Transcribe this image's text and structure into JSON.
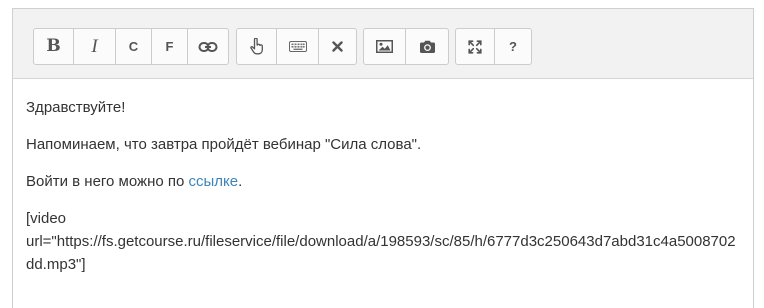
{
  "toolbar": {
    "formatting": {
      "bold_label": "B",
      "italic_label": "I",
      "c_label": "C",
      "f_label": "F"
    },
    "icons": {
      "link": "link-icon",
      "hand": "hand-pointer-icon",
      "keyboard": "keyboard-icon",
      "clear": "close-icon",
      "image": "image-icon",
      "camera": "camera-icon",
      "fullscreen": "fullscreen-icon"
    },
    "help_label": "?"
  },
  "content": {
    "greeting": "Здравствуйте!",
    "reminder": "Напоминаем, что завтра пройдёт вебинар \"Сила слова\".",
    "login_prefix": "Войти в него можно по ",
    "login_link": "ссылке",
    "login_suffix": ".",
    "video_open": "[video",
    "video_url_line": "url=\"https://fs.getcourse.ru/fileservice/file/download/a/198593/sc/85/h/6777d3c250643d7abd31c4a5008702dd.mp3\"]"
  },
  "colors": {
    "link": "#3d84b8",
    "toolbar_bg": "#f2f2f2",
    "text": "#333333"
  }
}
